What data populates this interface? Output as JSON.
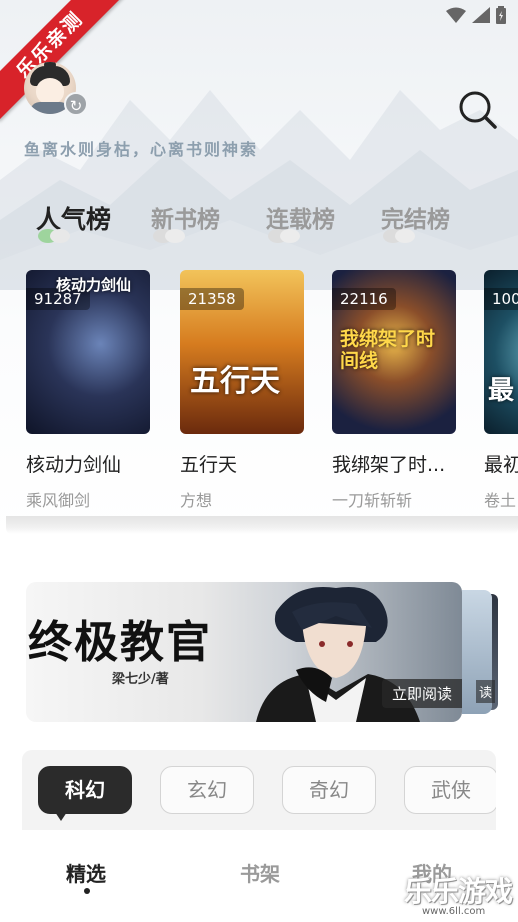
{
  "status_bar": {
    "icons": [
      "wifi-icon",
      "signal-icon",
      "battery-icon"
    ]
  },
  "ribbon": {
    "label": "乐乐亲测"
  },
  "header": {
    "motto": "鱼离水则身枯，心离书则神索",
    "refresh_icon": "↻"
  },
  "tabs": [
    {
      "label": "人气榜",
      "active": true
    },
    {
      "label": "新书榜",
      "active": false
    },
    {
      "label": "连载榜",
      "active": false
    },
    {
      "label": "完结榜",
      "active": false
    }
  ],
  "books": [
    {
      "count": "91287",
      "title": "核动力剑仙",
      "author": "乘风御剑",
      "cover_text": "核动力剑仙"
    },
    {
      "count": "21358",
      "title": "五行天",
      "author": "方想",
      "cover_text": "五行天"
    },
    {
      "count": "22116",
      "title": "我绑架了时...",
      "author": "一刀斩斩斩",
      "cover_text": "我绑架了时间线"
    },
    {
      "count": "100",
      "title": "最初",
      "author": "卷土",
      "cover_text": "最"
    }
  ],
  "banner": {
    "title": "终极教官",
    "author": "梁七少/著",
    "read_label": "立即阅读",
    "side_read_label": "读"
  },
  "categories": [
    {
      "label": "科幻",
      "active": true
    },
    {
      "label": "玄幻",
      "active": false
    },
    {
      "label": "奇幻",
      "active": false
    },
    {
      "label": "武侠",
      "active": false
    }
  ],
  "bottom_nav": [
    {
      "label": "精选",
      "active": true
    },
    {
      "label": "书架",
      "active": false
    },
    {
      "label": "我的",
      "active": false
    }
  ],
  "watermark": {
    "text": "乐乐游戏",
    "url": "www.6ll.com"
  },
  "colors": {
    "ribbon": "#d8232a",
    "accent_dark": "#2b2b2b",
    "motto": "#8d9fae"
  }
}
